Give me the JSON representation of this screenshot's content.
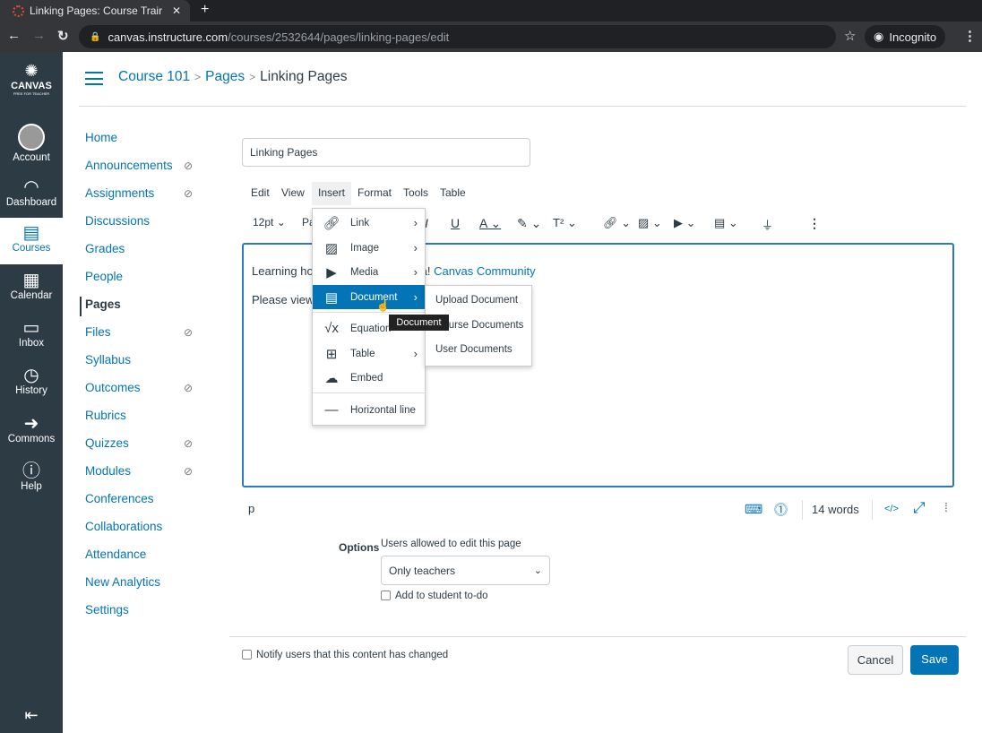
{
  "browser": {
    "tab_title": "Linking Pages: Course Trair",
    "url_host": "canvas.instructure.com",
    "url_path": "/courses/2532644/pages/linking-pages/edit",
    "profile": "Incognito"
  },
  "global_nav": {
    "logo": "CANVAS",
    "logo_sub": "FREE FOR TEACHER",
    "items": [
      {
        "label": "Account",
        "icon": "avatar-icon"
      },
      {
        "label": "Dashboard",
        "icon": "gauge-icon"
      },
      {
        "label": "Courses",
        "icon": "book-icon"
      },
      {
        "label": "Calendar",
        "icon": "calendar-icon"
      },
      {
        "label": "Inbox",
        "icon": "inbox-icon"
      },
      {
        "label": "History",
        "icon": "clock-icon"
      },
      {
        "label": "Commons",
        "icon": "commons-icon"
      },
      {
        "label": "Help",
        "icon": "help-icon"
      }
    ]
  },
  "breadcrumb": [
    "Course 101",
    "Pages",
    "Linking Pages"
  ],
  "course_nav": [
    {
      "label": "Home"
    },
    {
      "label": "Announcements",
      "hidden": true
    },
    {
      "label": "Assignments",
      "hidden": true
    },
    {
      "label": "Discussions"
    },
    {
      "label": "Grades"
    },
    {
      "label": "People"
    },
    {
      "label": "Pages",
      "active": true
    },
    {
      "label": "Files",
      "hidden": true
    },
    {
      "label": "Syllabus"
    },
    {
      "label": "Outcomes",
      "hidden": true
    },
    {
      "label": "Rubrics"
    },
    {
      "label": "Quizzes",
      "hidden": true
    },
    {
      "label": "Modules",
      "hidden": true
    },
    {
      "label": "Conferences"
    },
    {
      "label": "Collaborations"
    },
    {
      "label": "Attendance"
    },
    {
      "label": "New Analytics"
    },
    {
      "label": "Settings"
    }
  ],
  "editor": {
    "title_value": "Linking Pages",
    "menubar": [
      "Edit",
      "View",
      "Insert",
      "Format",
      "Tools",
      "Table"
    ],
    "font_size": "12pt",
    "paragraph": "Pa",
    "line1_prefix": "Learning ho",
    "line1_suffix": "a! ",
    "line1_link": "Canvas Community",
    "line2": "Please view",
    "status_tag": "p",
    "word_count": "14 words"
  },
  "insert_menu": [
    {
      "label": "Link",
      "icon": "link-icon",
      "sub": true
    },
    {
      "label": "Image",
      "icon": "image-icon",
      "sub": true
    },
    {
      "label": "Media",
      "icon": "media-icon",
      "sub": true
    },
    {
      "label": "Document",
      "icon": "document-icon",
      "sub": true,
      "highlighted": true
    },
    {
      "label": "Equation",
      "icon": "equation-icon"
    },
    {
      "label": "Table",
      "icon": "table-icon",
      "sub": true
    },
    {
      "label": "Embed",
      "icon": "embed-icon"
    },
    {
      "label": "Horizontal line",
      "icon": "horizontal-line-icon"
    }
  ],
  "document_submenu": [
    "Upload Document",
    "Course Documents",
    "User Documents"
  ],
  "tooltip": "Document",
  "options": {
    "label": "Options",
    "edit_label": "Users allowed to edit this page",
    "edit_value": "Only teachers",
    "todo_label": "Add to student to-do"
  },
  "footer": {
    "notify_label": "Notify users that this content has changed",
    "cancel": "Cancel",
    "save": "Save"
  },
  "colors": {
    "accent": "#0374b5",
    "nav_bg": "#2d3b45"
  }
}
